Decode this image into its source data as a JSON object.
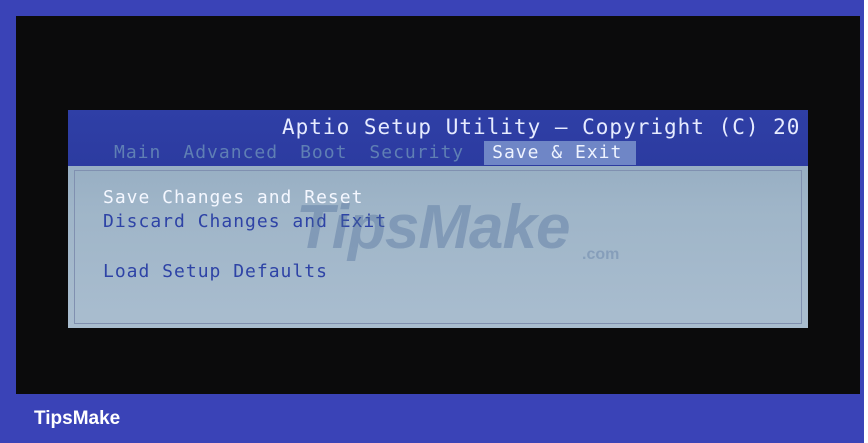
{
  "bios": {
    "title": "Aptio Setup Utility – Copyright (C) 20",
    "tabs": [
      {
        "label": "Main",
        "active": false
      },
      {
        "label": "Advanced",
        "active": false
      },
      {
        "label": "Boot",
        "active": false
      },
      {
        "label": "Security",
        "active": false
      },
      {
        "label": "Save & Exit",
        "active": true
      }
    ],
    "menu": {
      "save_changes_reset": "Save Changes and Reset",
      "discard_changes_exit": "Discard Changes and Exit",
      "load_setup_defaults": "Load Setup Defaults"
    }
  },
  "watermark": {
    "main": "TipsMake",
    "suffix": ".com"
  },
  "footer": {
    "brand": "TipsMake"
  },
  "colors": {
    "frame_blue": "#3a43b7",
    "bios_header": "#2f3fa6",
    "bios_body": "#9fb5c8",
    "menu_text": "#2e43a6",
    "selected_text": "#f4f7ff"
  }
}
